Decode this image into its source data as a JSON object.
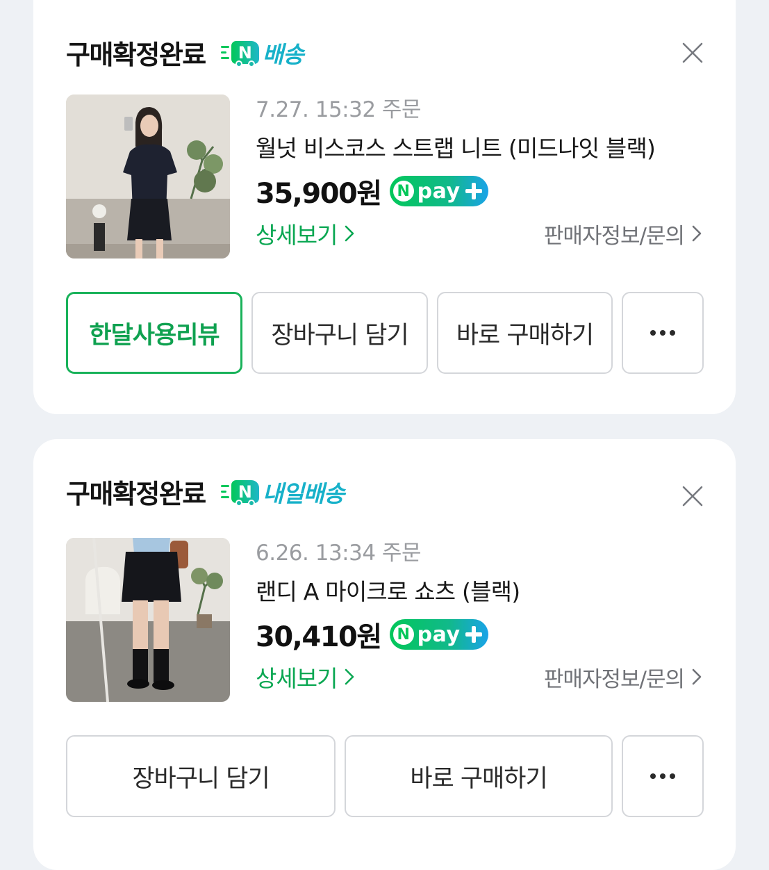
{
  "colors": {
    "accent_green": "#03c75a",
    "delivery_blue": "#17b1c9",
    "page_bg": "#eef1f5"
  },
  "orders": [
    {
      "status": "구매확정완료",
      "delivery_icon": "n-delivery-truck-icon",
      "delivery_icon_letter": "N",
      "delivery_label": "배송",
      "order_date": "7.27. 15:32 주문",
      "product_title": "월넛 비스코스 스트랩 니트 (미드나잇 블랙)",
      "price": "35,900원",
      "npay": {
        "n": "N",
        "word": "pay"
      },
      "detail_link": "상세보기",
      "seller_link": "판매자정보/문의",
      "buttons": {
        "review": "한달사용리뷰",
        "cart": "장바구니 담기",
        "buy_now": "바로 구매하기"
      }
    },
    {
      "status": "구매확정완료",
      "delivery_icon": "n-delivery-truck-icon",
      "delivery_icon_letter": "N",
      "delivery_label": "내일배송",
      "order_date": "6.26. 13:34 주문",
      "product_title": "랜디 A 마이크로 쇼츠 (블랙)",
      "price": "30,410원",
      "npay": {
        "n": "N",
        "word": "pay"
      },
      "detail_link": "상세보기",
      "seller_link": "판매자정보/문의",
      "buttons": {
        "cart": "장바구니 담기",
        "buy_now": "바로 구매하기"
      }
    }
  ]
}
